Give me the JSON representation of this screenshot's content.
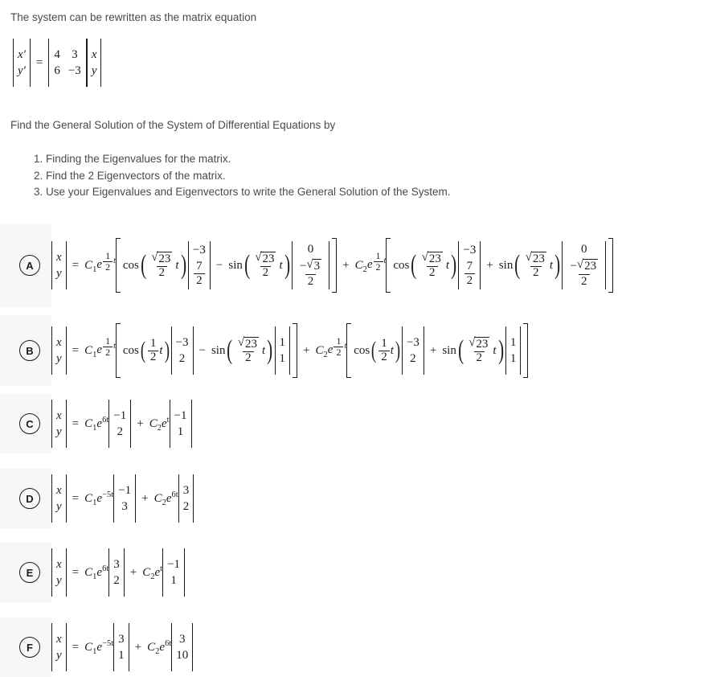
{
  "intro_text": "The system can be rewritten as the matrix equation",
  "find_text": "Find the General Solution of the System of Differential Equations by",
  "steps": [
    "1. Finding the Eigenvalues for the matrix.",
    "2. Find the 2 Eigenvectors of the matrix.",
    "3. Use your Eigenvalues and Eigenvectors to write the General Solution of the System."
  ],
  "matrix_equation": {
    "lhs": {
      "top": "x'",
      "bottom": "y'"
    },
    "equals": "=",
    "matrix": {
      "a11": "4",
      "a12": "3",
      "a21": "6",
      "a22": "−3"
    },
    "rhs": {
      "top": "x",
      "bottom": "y"
    }
  },
  "options": [
    {
      "letter": "A",
      "lhs_top": "x",
      "lhs_bottom": "y",
      "equals": "=",
      "terms": [
        {
          "coef": "C",
          "coef_sub": "1",
          "exp_base": "e",
          "exp_num": "1",
          "exp_den": "2",
          "exp_var": "t",
          "trig1": "cos",
          "arg1_sqrt": "23",
          "arg1_den": "2",
          "arg1_var": "t",
          "vec1_top": "−3",
          "vec1_bottom_num": "7",
          "vec1_bottom_den": "2",
          "operator": "−",
          "trig2": "sin",
          "arg2_sqrt": "23",
          "arg2_den": "2",
          "arg2_var": "t",
          "vec2_top": "0",
          "vec2_bottom_sqrt": "3",
          "vec2_bottom_den": "2"
        },
        {
          "coef": "C",
          "coef_sub": "2",
          "exp_base": "e",
          "exp_num": "1",
          "exp_den": "2",
          "exp_var": "t",
          "trig1": "cos",
          "arg1_sqrt": "23",
          "arg1_den": "2",
          "arg1_var": "t",
          "vec1_top": "−3",
          "vec1_bottom_num": "7",
          "vec1_bottom_den": "2",
          "operator": "+",
          "trig2": "sin",
          "arg2_sqrt": "23",
          "arg2_den": "2",
          "arg2_var": "t",
          "vec2_top": "0",
          "vec2_bottom_sqrt": "23",
          "vec2_bottom_den": "2"
        }
      ],
      "join": "+"
    },
    {
      "letter": "B",
      "lhs_top": "x",
      "lhs_bottom": "y",
      "equals": "=",
      "terms": [
        {
          "coef": "C",
          "coef_sub": "1",
          "exp_base": "e",
          "exp_num": "1",
          "exp_den": "2",
          "exp_var": "t",
          "trig1": "cos",
          "arg1_num": "1",
          "arg1_den": "2",
          "arg1_var": "t",
          "vec1_top": "−3",
          "vec1_bottom": "2",
          "operator": "−",
          "trig2": "sin",
          "arg2_sqrt": "23",
          "arg2_den": "2",
          "arg2_var": "t",
          "vec2_top": "1",
          "vec2_bottom": "1"
        },
        {
          "coef": "C",
          "coef_sub": "2",
          "exp_base": "e",
          "exp_num": "1",
          "exp_den": "2",
          "exp_var": "t",
          "trig1": "cos",
          "arg1_num": "1",
          "arg1_den": "2",
          "arg1_var": "t",
          "vec1_top": "−3",
          "vec1_bottom": "2",
          "operator": "+",
          "trig2": "sin",
          "arg2_sqrt": "23",
          "arg2_den": "2",
          "arg2_var": "t",
          "vec2_top": "1",
          "vec2_bottom": "1"
        }
      ],
      "join": "+"
    },
    {
      "letter": "C",
      "lhs_top": "x",
      "lhs_bottom": "y",
      "equals": "=",
      "join": "+",
      "simple_terms": [
        {
          "coef": "C",
          "coef_sub": "1",
          "exp_base": "e",
          "exp_sup": "6t",
          "vec_top": "−1",
          "vec_bottom": "2"
        },
        {
          "coef": "C",
          "coef_sub": "2",
          "exp_base": "e",
          "exp_sup": "t",
          "vec_top": "−1",
          "vec_bottom": "1"
        }
      ]
    },
    {
      "letter": "D",
      "lhs_top": "x",
      "lhs_bottom": "y",
      "equals": "=",
      "join": "+",
      "simple_terms": [
        {
          "coef": "C",
          "coef_sub": "1",
          "exp_base": "e",
          "exp_sup": "−5t",
          "vec_top": "−1",
          "vec_bottom": "3"
        },
        {
          "coef": "C",
          "coef_sub": "2",
          "exp_base": "e",
          "exp_sup": "6t",
          "vec_top": "3",
          "vec_bottom": "2"
        }
      ]
    },
    {
      "letter": "E",
      "lhs_top": "x",
      "lhs_bottom": "y",
      "equals": "=",
      "join": "+",
      "simple_terms": [
        {
          "coef": "C",
          "coef_sub": "1",
          "exp_base": "e",
          "exp_sup": "6t",
          "vec_top": "3",
          "vec_bottom": "2"
        },
        {
          "coef": "C",
          "coef_sub": "2",
          "exp_base": "e",
          "exp_sup": "t",
          "vec_top": "−1",
          "vec_bottom": "1"
        }
      ]
    },
    {
      "letter": "F",
      "lhs_top": "x",
      "lhs_bottom": "y",
      "equals": "=",
      "join": "+",
      "simple_terms": [
        {
          "coef": "C",
          "coef_sub": "1",
          "exp_base": "e",
          "exp_sup": "−5t",
          "vec_top": "3",
          "vec_bottom": "1"
        },
        {
          "coef": "C",
          "coef_sub": "2",
          "exp_base": "e",
          "exp_sup": "6t",
          "vec_top": "3",
          "vec_bottom": "10"
        }
      ]
    }
  ],
  "symbols": {
    "radical": "√",
    "paren_open": "(",
    "paren_close": ")"
  },
  "colors": {
    "row_background": "#f7f7f7",
    "page_background": "#ffffff",
    "text": "#4a4a4a",
    "math_text": "#1c1c1c"
  }
}
